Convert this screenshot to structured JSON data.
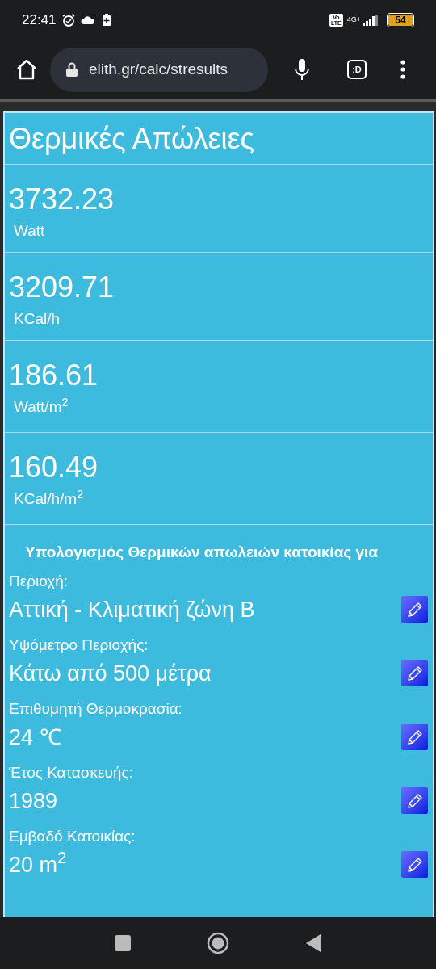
{
  "status_bar": {
    "time": "22:41",
    "volte": "Vo\nLTE",
    "network": "4G+",
    "battery": "54"
  },
  "browser": {
    "url": "elith.gr/calc/stresults",
    "tab_label": ":D"
  },
  "title": "Θερμικές Απώλειες",
  "results": [
    {
      "value": "3732.23",
      "unit": "Watt"
    },
    {
      "value": "3209.71",
      "unit": "KCal/h"
    },
    {
      "value": "186.61",
      "unit": "Watt/m$^{2}$"
    },
    {
      "value": "160.49",
      "unit": "KCal/h/m$^{2}$"
    }
  ],
  "details_heading": "Υπολογισμός Θερμικών απωλειών κατοικίας για",
  "details": [
    {
      "label": "Περιοχή:",
      "value": "Αττική - Κλιματική ζώνη Β"
    },
    {
      "label": "Υψόμετρο Περιοχής:",
      "value": "Κάτω από 500 μέτρα"
    },
    {
      "label": "Επιθυμητή Θερμοκρασία:",
      "value": "24 ℃"
    },
    {
      "label": "Έτος Κατασκευής:",
      "value": "1989"
    },
    {
      "label": "Εμβαδό Κατοικίας:",
      "value": "20 m$^{2}$"
    }
  ]
}
